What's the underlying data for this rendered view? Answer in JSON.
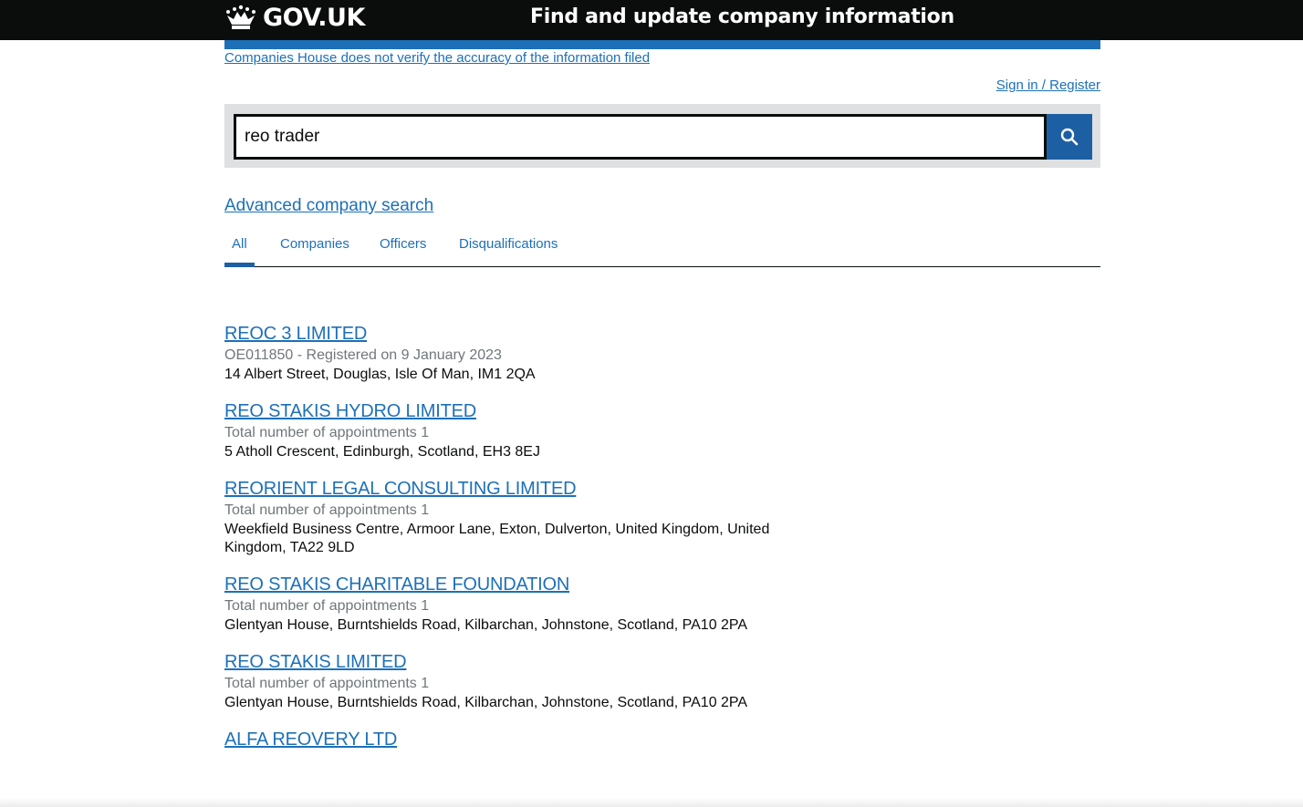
{
  "header": {
    "logo_text": "GOV.UK",
    "service_name": "Find and update company information"
  },
  "disclaimer": "Companies House does not verify the accuracy of the information filed",
  "signin": "Sign in / Register",
  "search": {
    "value": "reo trader",
    "button_icon": "search-icon"
  },
  "advanced_search": "Advanced company search",
  "tabs": [
    {
      "label": "All",
      "selected": true
    },
    {
      "label": "Companies",
      "selected": false
    },
    {
      "label": "Officers",
      "selected": false
    },
    {
      "label": "Disqualifications",
      "selected": false
    }
  ],
  "results": [
    {
      "title": "REOC 3 LIMITED",
      "meta": "OE011850 - Registered on 9 January 2023",
      "address": "14 Albert Street, Douglas, Isle Of Man, IM1 2QA"
    },
    {
      "title": "REO STAKIS HYDRO LIMITED",
      "meta": "Total number of appointments 1",
      "address": "5 Atholl Crescent, Edinburgh, Scotland, EH3 8EJ"
    },
    {
      "title": "REORIENT LEGAL CONSULTING LIMITED",
      "meta": "Total number of appointments 1",
      "address": "Weekfield Business Centre, Armoor Lane, Exton, Dulverton, United Kingdom, United Kingdom, TA22 9LD"
    },
    {
      "title": "REO STAKIS CHARITABLE FOUNDATION",
      "meta": "Total number of appointments 1",
      "address": "Glentyan House, Burntshields Road, Kilbarchan, Johnstone, Scotland, PA10 2PA"
    },
    {
      "title": "REO STAKIS LIMITED",
      "meta": "Total number of appointments 1",
      "address": "Glentyan House, Burntshields Road, Kilbarchan, Johnstone, Scotland, PA10 2PA"
    },
    {
      "title": "ALFA REOVERY LTD",
      "meta": "",
      "address": ""
    }
  ],
  "colors": {
    "header_bg": "#0b0c0c",
    "link": "#1d70b8",
    "search_button": "#1d5fa3",
    "search_panel": "#dee0e2",
    "meta_text": "#6f777b"
  }
}
